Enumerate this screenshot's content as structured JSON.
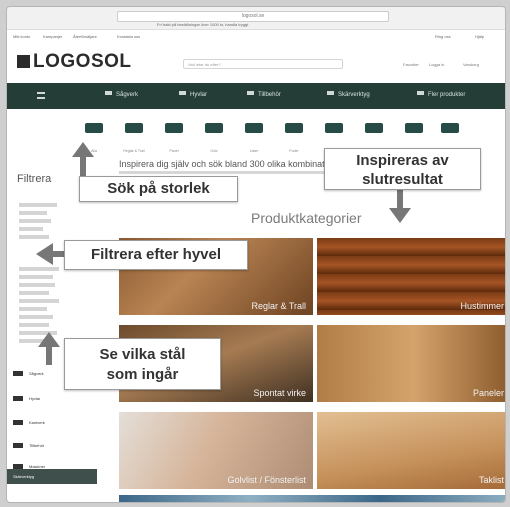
{
  "browser": {
    "url": "logosol.se",
    "notice": "Fri frakt på beställningar över 1000 kr, handla tryggt"
  },
  "utility": {
    "left": [
      "Mitt konto",
      "Kampanjer",
      "Återförsäljare",
      "Kontakta oss"
    ],
    "right": [
      "Ring oss",
      "Hjälp"
    ]
  },
  "header": {
    "logo": "LOGOSOL",
    "search_placeholder": "Vad letar du efter?",
    "account_links": [
      "Favoriter",
      "Logga in",
      "Varukorg"
    ]
  },
  "nav": {
    "items": [
      {
        "label": "Sågverk",
        "icon": "saw-icon"
      },
      {
        "label": "Hyvlar",
        "icon": "planer-icon"
      },
      {
        "label": "Tillbehör",
        "icon": "accessory-icon"
      },
      {
        "label": "Skärverktyg",
        "icon": "blade-icon"
      },
      {
        "label": "Fler produkter",
        "icon": "more-icon"
      }
    ]
  },
  "sizes": [
    "Alla",
    "Reglar & Trall",
    "Panel",
    "Golv",
    "Lister",
    "Foder",
    "Fasad",
    "Tak",
    "Balk",
    "Övrigt"
  ],
  "sidebar": {
    "title": "Filtrera",
    "categories": [
      {
        "label": "Sågverk",
        "icon": "saw-icon"
      },
      {
        "label": "Hyvlar",
        "icon": "planer-icon"
      },
      {
        "label": "Kantverk",
        "icon": "edger-icon"
      },
      {
        "label": "Tillbehör",
        "icon": "accessory-icon"
      },
      {
        "label": "Maskiner",
        "icon": "machine-icon"
      },
      {
        "label": "Skärverktyg",
        "icon": "blade-icon"
      }
    ]
  },
  "main": {
    "inspire_text": "Inspirera dig själv och sök bland 300 olika kombinationer",
    "section_title": "Produktkategorier",
    "tiles": [
      "Reglar & Trall",
      "Hustimmer",
      "Spontat virke",
      "Paneler",
      "Golvlist / Fönsterlist",
      "Taklist"
    ]
  },
  "callouts": {
    "size": "Sök på storlek",
    "inspire_line1": "Inspireras av",
    "inspire_line2": "slutresultat",
    "filter": "Filtrera efter hyvel",
    "steel_line1": "Se vilka stål",
    "steel_line2": "som ingår"
  }
}
